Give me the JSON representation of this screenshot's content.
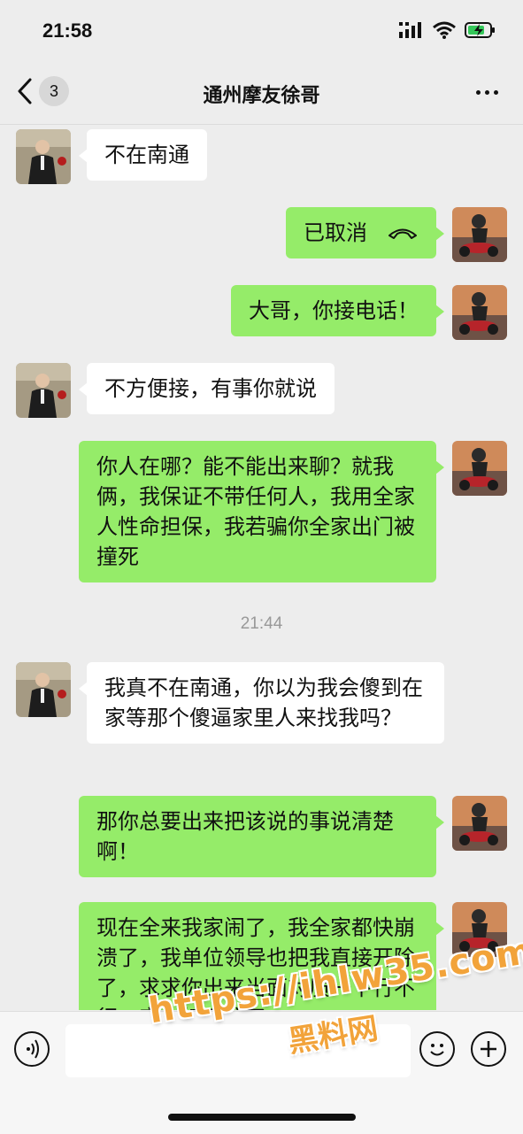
{
  "status_bar": {
    "time": "21:58"
  },
  "nav": {
    "back_count": "3",
    "title": "通州摩友徐哥"
  },
  "messages": [
    {
      "side": "in",
      "text": "不在南通"
    },
    {
      "side": "out",
      "text": "已取消"
    },
    {
      "side": "out",
      "text": "大哥，你接电话！"
    },
    {
      "side": "in",
      "text": "不方便接，有事你就说"
    },
    {
      "side": "out",
      "text": "你人在哪？能不能出来聊？就我俩，我保证不带任何人，我用全家人性命担保，我若骗你全家出门被撞死"
    },
    {
      "side": "time",
      "text": "21:44"
    },
    {
      "side": "in",
      "text": "我真不在南通，你以为我会傻到在家等那个傻逼家里人来找我吗？"
    },
    {
      "side": "out",
      "text": "那你总要出来把该说的事说清楚啊！"
    },
    {
      "side": "out",
      "text": "现在全来我家闹了，我全家都快崩溃了，我单位领导也把我直接开除了，求求你出来当面对质一下行不行，实在扛不住了"
    }
  ],
  "input": {
    "placeholder": ""
  },
  "watermark": {
    "url": "https://ihlw35.com",
    "name": "黑料网"
  },
  "colors": {
    "out_bubble": "#95ec69",
    "in_bubble": "#ffffff",
    "background": "#ededed",
    "watermark": "#f2a33a"
  }
}
